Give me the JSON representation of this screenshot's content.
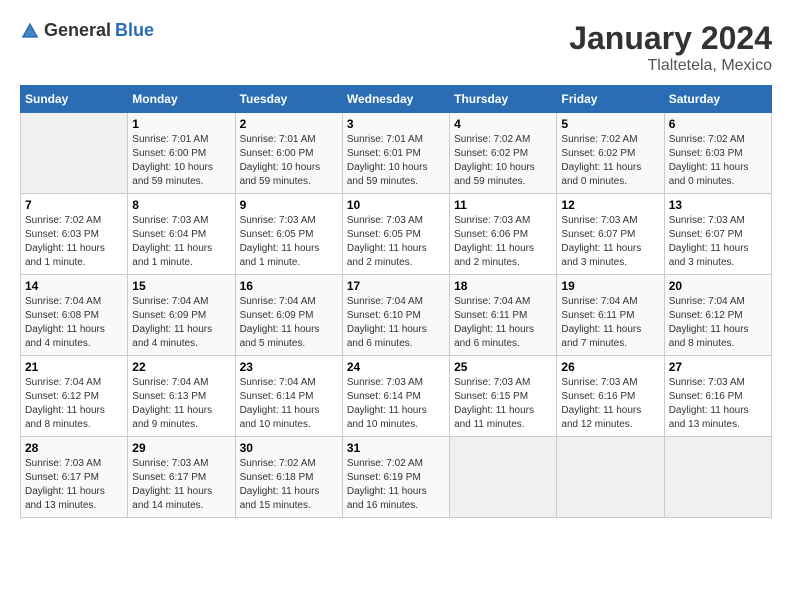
{
  "header": {
    "logo_general": "General",
    "logo_blue": "Blue",
    "title": "January 2024",
    "subtitle": "Tlaltetela, Mexico"
  },
  "calendar": {
    "weekdays": [
      "Sunday",
      "Monday",
      "Tuesday",
      "Wednesday",
      "Thursday",
      "Friday",
      "Saturday"
    ],
    "weeks": [
      [
        {
          "day": "",
          "sunrise": "",
          "sunset": "",
          "daylight": ""
        },
        {
          "day": "1",
          "sunrise": "Sunrise: 7:01 AM",
          "sunset": "Sunset: 6:00 PM",
          "daylight": "Daylight: 10 hours and 59 minutes."
        },
        {
          "day": "2",
          "sunrise": "Sunrise: 7:01 AM",
          "sunset": "Sunset: 6:00 PM",
          "daylight": "Daylight: 10 hours and 59 minutes."
        },
        {
          "day": "3",
          "sunrise": "Sunrise: 7:01 AM",
          "sunset": "Sunset: 6:01 PM",
          "daylight": "Daylight: 10 hours and 59 minutes."
        },
        {
          "day": "4",
          "sunrise": "Sunrise: 7:02 AM",
          "sunset": "Sunset: 6:02 PM",
          "daylight": "Daylight: 10 hours and 59 minutes."
        },
        {
          "day": "5",
          "sunrise": "Sunrise: 7:02 AM",
          "sunset": "Sunset: 6:02 PM",
          "daylight": "Daylight: 11 hours and 0 minutes."
        },
        {
          "day": "6",
          "sunrise": "Sunrise: 7:02 AM",
          "sunset": "Sunset: 6:03 PM",
          "daylight": "Daylight: 11 hours and 0 minutes."
        }
      ],
      [
        {
          "day": "7",
          "sunrise": "Sunrise: 7:02 AM",
          "sunset": "Sunset: 6:03 PM",
          "daylight": "Daylight: 11 hours and 1 minute."
        },
        {
          "day": "8",
          "sunrise": "Sunrise: 7:03 AM",
          "sunset": "Sunset: 6:04 PM",
          "daylight": "Daylight: 11 hours and 1 minute."
        },
        {
          "day": "9",
          "sunrise": "Sunrise: 7:03 AM",
          "sunset": "Sunset: 6:05 PM",
          "daylight": "Daylight: 11 hours and 1 minute."
        },
        {
          "day": "10",
          "sunrise": "Sunrise: 7:03 AM",
          "sunset": "Sunset: 6:05 PM",
          "daylight": "Daylight: 11 hours and 2 minutes."
        },
        {
          "day": "11",
          "sunrise": "Sunrise: 7:03 AM",
          "sunset": "Sunset: 6:06 PM",
          "daylight": "Daylight: 11 hours and 2 minutes."
        },
        {
          "day": "12",
          "sunrise": "Sunrise: 7:03 AM",
          "sunset": "Sunset: 6:07 PM",
          "daylight": "Daylight: 11 hours and 3 minutes."
        },
        {
          "day": "13",
          "sunrise": "Sunrise: 7:03 AM",
          "sunset": "Sunset: 6:07 PM",
          "daylight": "Daylight: 11 hours and 3 minutes."
        }
      ],
      [
        {
          "day": "14",
          "sunrise": "Sunrise: 7:04 AM",
          "sunset": "Sunset: 6:08 PM",
          "daylight": "Daylight: 11 hours and 4 minutes."
        },
        {
          "day": "15",
          "sunrise": "Sunrise: 7:04 AM",
          "sunset": "Sunset: 6:09 PM",
          "daylight": "Daylight: 11 hours and 4 minutes."
        },
        {
          "day": "16",
          "sunrise": "Sunrise: 7:04 AM",
          "sunset": "Sunset: 6:09 PM",
          "daylight": "Daylight: 11 hours and 5 minutes."
        },
        {
          "day": "17",
          "sunrise": "Sunrise: 7:04 AM",
          "sunset": "Sunset: 6:10 PM",
          "daylight": "Daylight: 11 hours and 6 minutes."
        },
        {
          "day": "18",
          "sunrise": "Sunrise: 7:04 AM",
          "sunset": "Sunset: 6:11 PM",
          "daylight": "Daylight: 11 hours and 6 minutes."
        },
        {
          "day": "19",
          "sunrise": "Sunrise: 7:04 AM",
          "sunset": "Sunset: 6:11 PM",
          "daylight": "Daylight: 11 hours and 7 minutes."
        },
        {
          "day": "20",
          "sunrise": "Sunrise: 7:04 AM",
          "sunset": "Sunset: 6:12 PM",
          "daylight": "Daylight: 11 hours and 8 minutes."
        }
      ],
      [
        {
          "day": "21",
          "sunrise": "Sunrise: 7:04 AM",
          "sunset": "Sunset: 6:12 PM",
          "daylight": "Daylight: 11 hours and 8 minutes."
        },
        {
          "day": "22",
          "sunrise": "Sunrise: 7:04 AM",
          "sunset": "Sunset: 6:13 PM",
          "daylight": "Daylight: 11 hours and 9 minutes."
        },
        {
          "day": "23",
          "sunrise": "Sunrise: 7:04 AM",
          "sunset": "Sunset: 6:14 PM",
          "daylight": "Daylight: 11 hours and 10 minutes."
        },
        {
          "day": "24",
          "sunrise": "Sunrise: 7:03 AM",
          "sunset": "Sunset: 6:14 PM",
          "daylight": "Daylight: 11 hours and 10 minutes."
        },
        {
          "day": "25",
          "sunrise": "Sunrise: 7:03 AM",
          "sunset": "Sunset: 6:15 PM",
          "daylight": "Daylight: 11 hours and 11 minutes."
        },
        {
          "day": "26",
          "sunrise": "Sunrise: 7:03 AM",
          "sunset": "Sunset: 6:16 PM",
          "daylight": "Daylight: 11 hours and 12 minutes."
        },
        {
          "day": "27",
          "sunrise": "Sunrise: 7:03 AM",
          "sunset": "Sunset: 6:16 PM",
          "daylight": "Daylight: 11 hours and 13 minutes."
        }
      ],
      [
        {
          "day": "28",
          "sunrise": "Sunrise: 7:03 AM",
          "sunset": "Sunset: 6:17 PM",
          "daylight": "Daylight: 11 hours and 13 minutes."
        },
        {
          "day": "29",
          "sunrise": "Sunrise: 7:03 AM",
          "sunset": "Sunset: 6:17 PM",
          "daylight": "Daylight: 11 hours and 14 minutes."
        },
        {
          "day": "30",
          "sunrise": "Sunrise: 7:02 AM",
          "sunset": "Sunset: 6:18 PM",
          "daylight": "Daylight: 11 hours and 15 minutes."
        },
        {
          "day": "31",
          "sunrise": "Sunrise: 7:02 AM",
          "sunset": "Sunset: 6:19 PM",
          "daylight": "Daylight: 11 hours and 16 minutes."
        },
        {
          "day": "",
          "sunrise": "",
          "sunset": "",
          "daylight": ""
        },
        {
          "day": "",
          "sunrise": "",
          "sunset": "",
          "daylight": ""
        },
        {
          "day": "",
          "sunrise": "",
          "sunset": "",
          "daylight": ""
        }
      ]
    ]
  }
}
